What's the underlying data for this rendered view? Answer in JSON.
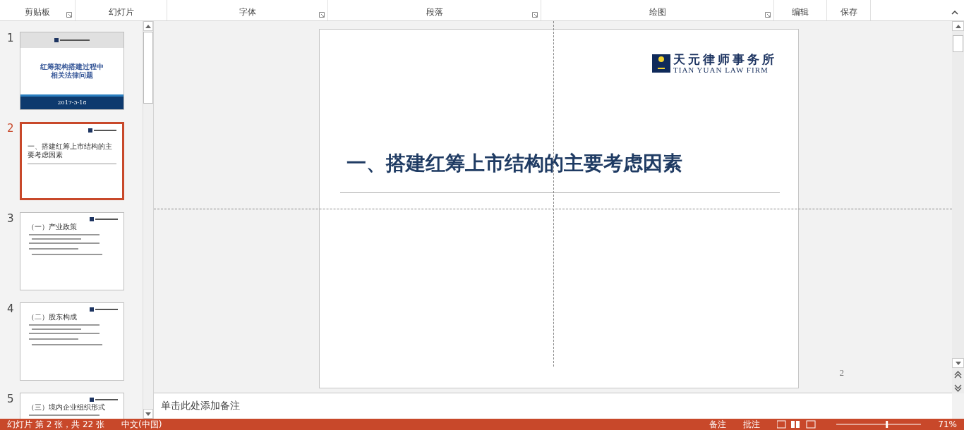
{
  "ribbon": {
    "groups": [
      {
        "label": "剪贴板",
        "launcher": true
      },
      {
        "label": "幻灯片",
        "launcher": false
      },
      {
        "label": "字体",
        "launcher": true
      },
      {
        "label": "段落",
        "launcher": true
      },
      {
        "label": "绘图",
        "launcher": true
      },
      {
        "label": "编辑",
        "launcher": false
      },
      {
        "label": "保存",
        "launcher": false
      }
    ]
  },
  "thumbnails": [
    {
      "number": "1",
      "selected": false,
      "kind": "cover",
      "title_lines": [
        "红筹架构搭建过程中",
        "相关法律问题"
      ],
      "date": "2017-3-18"
    },
    {
      "number": "2",
      "selected": true,
      "kind": "section",
      "title": "一、搭建红筹上市结构的主要考虑因素"
    },
    {
      "number": "3",
      "selected": false,
      "kind": "bullets",
      "title": "（一）产业政策"
    },
    {
      "number": "4",
      "selected": false,
      "kind": "bullets",
      "title": "（二）股东构成"
    },
    {
      "number": "5",
      "selected": false,
      "kind": "bullets",
      "title": "（三）境内企业组织形式"
    }
  ],
  "slide": {
    "logo_cn": "天元律师事务所",
    "logo_en": "TIAN YUAN LAW FIRM",
    "title": "一、搭建红筹上市结构的主要考虑因素"
  },
  "page_number": "2",
  "notes": {
    "placeholder": "单击此处添加备注"
  },
  "status_bar": {
    "slide_info": "幻灯片 第 2 张，共 22 张",
    "language": "中文(中国)",
    "notes": "备注",
    "comments": "批注",
    "zoom": "71%",
    "zoom_slider": {
      "level": 0.6
    }
  }
}
